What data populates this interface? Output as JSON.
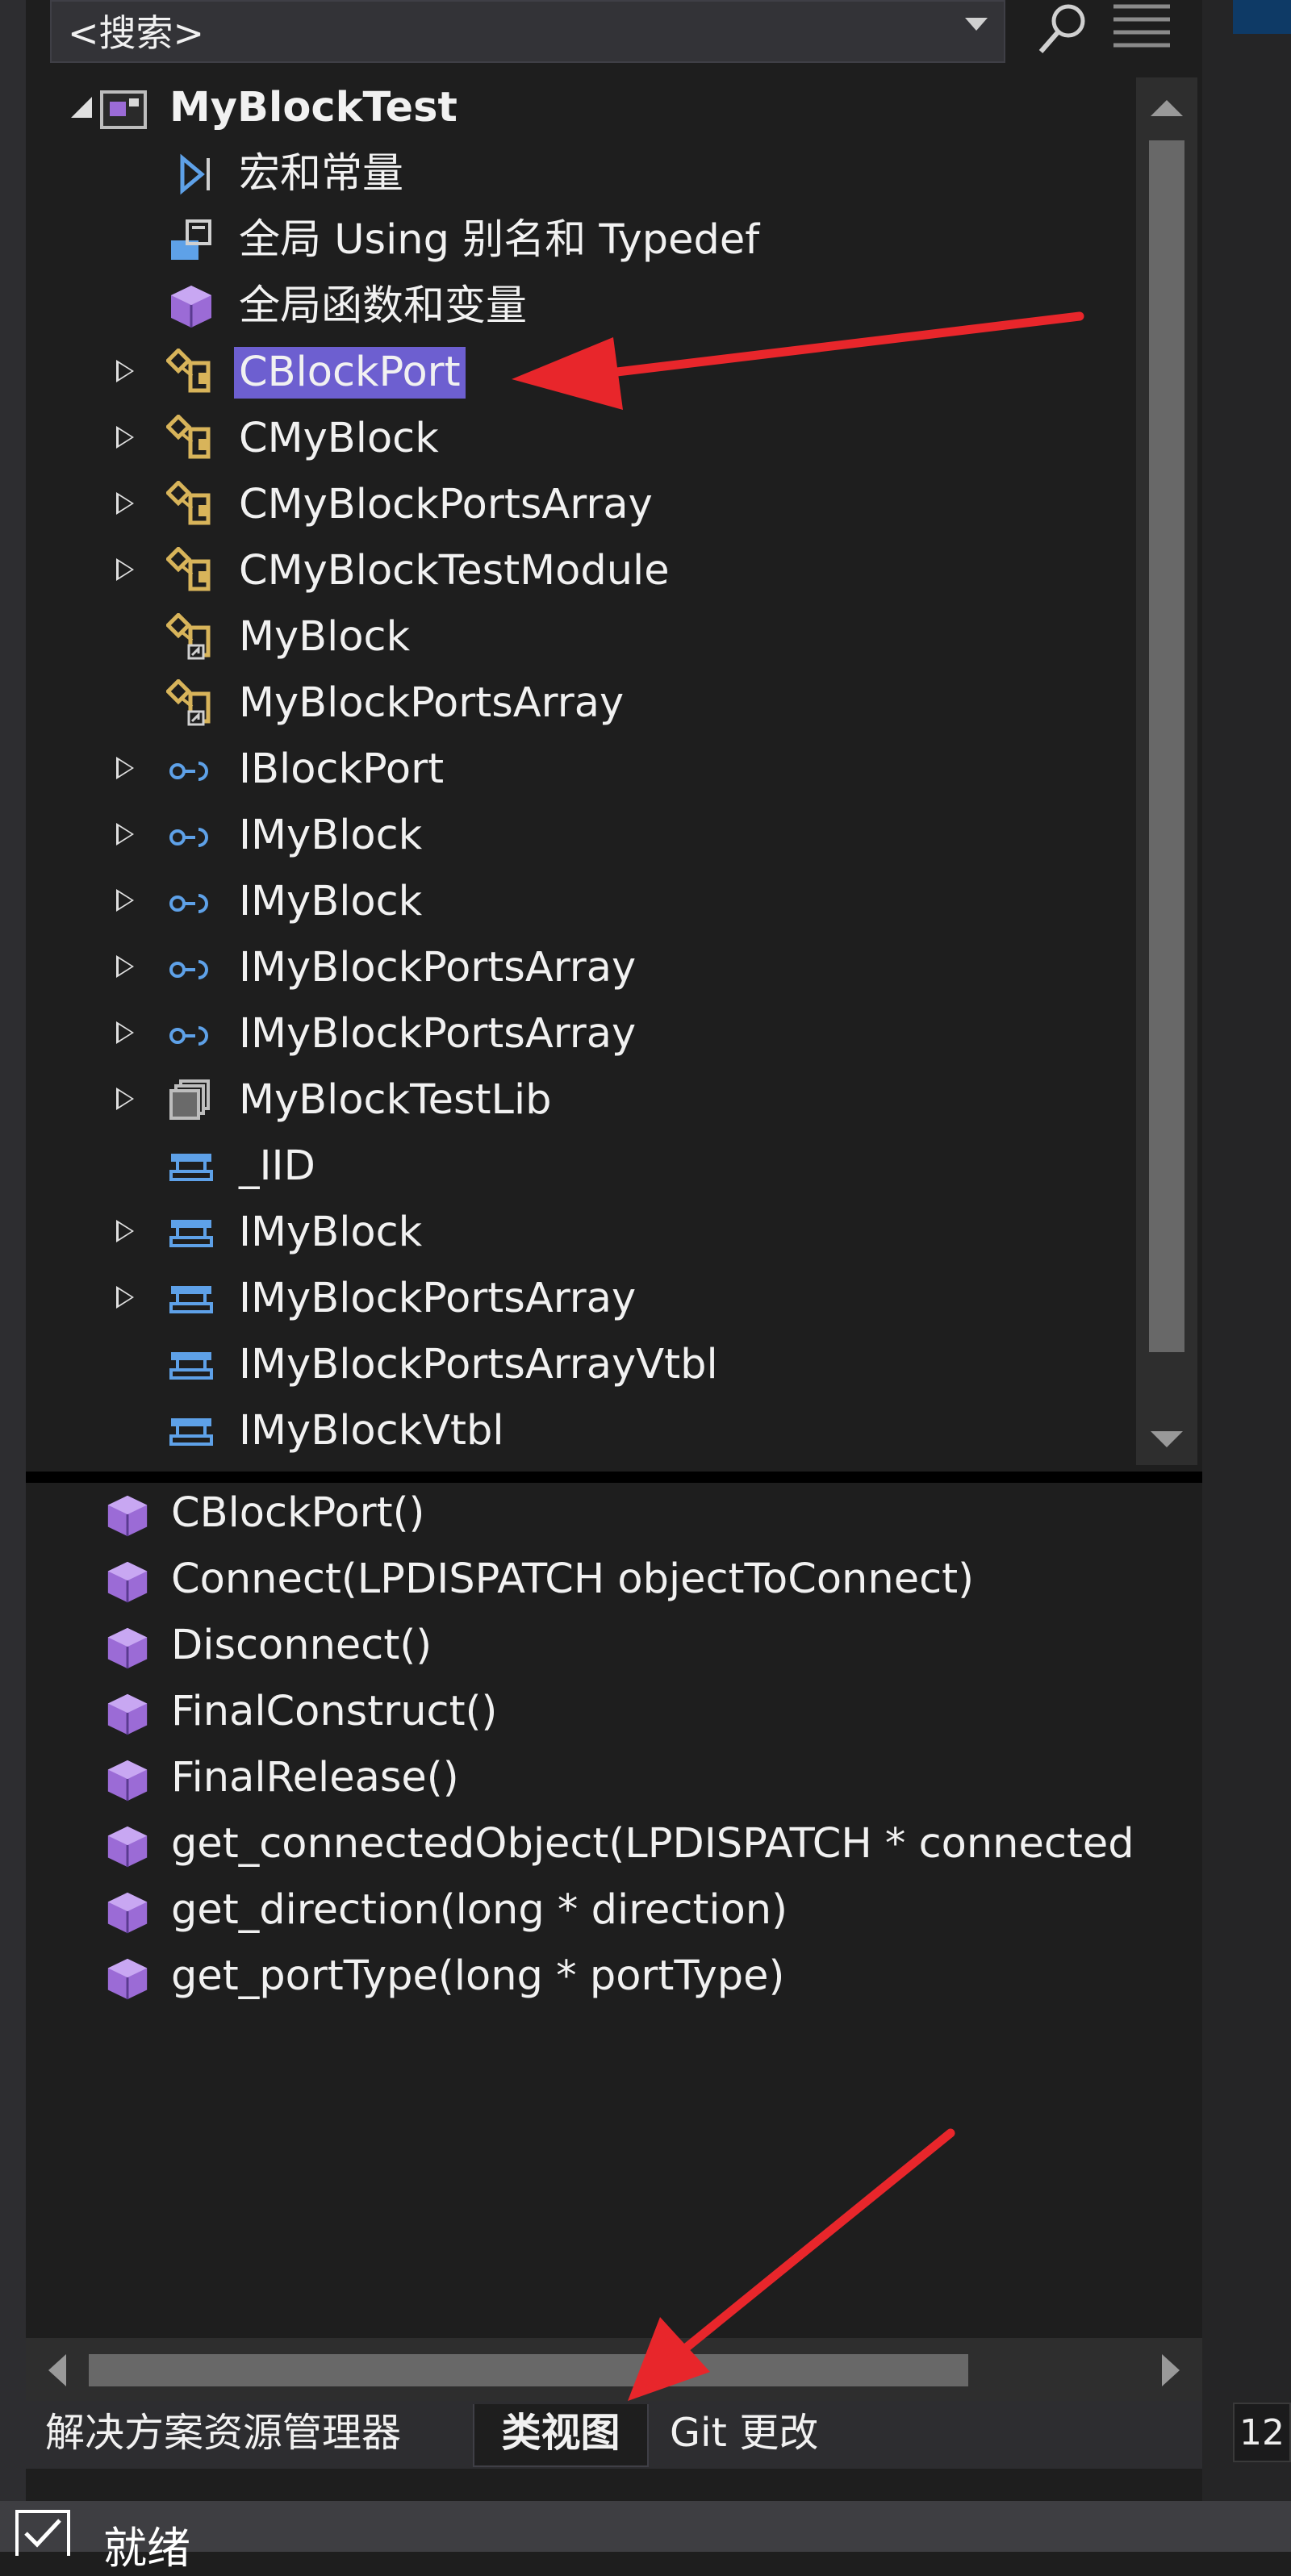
{
  "search": {
    "text": "<搜索>"
  },
  "tree": {
    "root": {
      "label": "MyBlockTest"
    },
    "items": [
      {
        "label": "宏和常量",
        "icon": "macro-icon",
        "expandable": false
      },
      {
        "label": "全局 Using 别名和 Typedef",
        "icon": "typedef-icon",
        "expandable": false
      },
      {
        "label": "全局函数和变量",
        "icon": "cube-icon",
        "expandable": false
      },
      {
        "label": "CBlockPort",
        "icon": "class-icon",
        "expandable": true,
        "selected": true
      },
      {
        "label": "CMyBlock",
        "icon": "class-icon",
        "expandable": true
      },
      {
        "label": "CMyBlockPortsArray",
        "icon": "class-icon",
        "expandable": true
      },
      {
        "label": "CMyBlockTestModule",
        "icon": "class-icon",
        "expandable": true
      },
      {
        "label": "MyBlock",
        "icon": "class-shortcut-icon",
        "expandable": false
      },
      {
        "label": "MyBlockPortsArray",
        "icon": "class-shortcut-icon",
        "expandable": false
      },
      {
        "label": "IBlockPort",
        "icon": "interface-icon",
        "expandable": true
      },
      {
        "label": "IMyBlock",
        "icon": "interface-icon",
        "expandable": true
      },
      {
        "label": "IMyBlock",
        "icon": "interface-icon",
        "expandable": true
      },
      {
        "label": "IMyBlockPortsArray",
        "icon": "interface-icon",
        "expandable": true
      },
      {
        "label": "IMyBlockPortsArray",
        "icon": "interface-icon",
        "expandable": true
      },
      {
        "label": "MyBlockTestLib",
        "icon": "library-icon",
        "expandable": true
      },
      {
        "label": "_IID",
        "icon": "struct-icon",
        "expandable": false
      },
      {
        "label": "IMyBlock",
        "icon": "struct-icon",
        "expandable": true
      },
      {
        "label": "IMyBlockPortsArray",
        "icon": "struct-icon",
        "expandable": true
      },
      {
        "label": "IMyBlockPortsArrayVtbl",
        "icon": "struct-icon",
        "expandable": false
      },
      {
        "label": "IMyBlockVtbl",
        "icon": "struct-icon",
        "expandable": false
      }
    ]
  },
  "members": [
    "CBlockPort()",
    "Connect(LPDISPATCH objectToConnect)",
    "Disconnect()",
    "FinalConstruct()",
    "FinalRelease()",
    "get_connectedObject(LPDISPATCH * connected",
    "get_direction(long * direction)",
    "get_portType(long * portType)"
  ],
  "tabs": [
    {
      "label": "解决方案资源管理器",
      "active": false
    },
    {
      "label": "类视图",
      "active": true
    },
    {
      "label": "Git 更改",
      "active": false
    }
  ],
  "status": {
    "text": "就绪"
  },
  "line_col": "12",
  "colors": {
    "selection": "#6d5fd0",
    "arrow": "#e8262b",
    "class_icon": "#d8b45a",
    "interface_icon": "#5ea1e8",
    "member_icon": "#9b6bd6"
  }
}
